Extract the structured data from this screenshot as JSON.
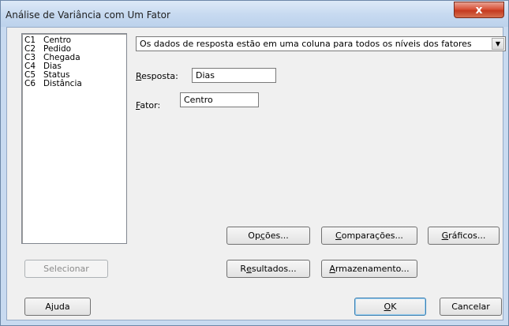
{
  "window": {
    "title": "Análise de Variância com Um Fator",
    "close_glyph": "x"
  },
  "variables": [
    {
      "code": "C1",
      "name": "Centro"
    },
    {
      "code": "C2",
      "name": "Pedido"
    },
    {
      "code": "C3",
      "name": "Chegada"
    },
    {
      "code": "C4",
      "name": "Dias"
    },
    {
      "code": "C5",
      "name": "Status"
    },
    {
      "code": "C6",
      "name": "Distância"
    }
  ],
  "data_layout": {
    "selected": "Os dados de resposta estão em uma coluna para todos os níveis dos fatores",
    "arrow_glyph": "▼"
  },
  "fields": {
    "response": {
      "label_first": "R",
      "label_rest": "esposta:",
      "value": "Dias"
    },
    "factor": {
      "label_first": "F",
      "label_rest": "ator:",
      "value": "Centro"
    }
  },
  "buttons": {
    "options": {
      "pre": "Op",
      "key": "ç",
      "post": "ões..."
    },
    "comparisons": {
      "pre": "",
      "key": "C",
      "post": "omparações..."
    },
    "graphs": {
      "pre": "",
      "key": "G",
      "post": "ráficos..."
    },
    "select": {
      "label": "Selecionar"
    },
    "results": {
      "pre": "R",
      "key": "e",
      "post": "sultados..."
    },
    "storage": {
      "pre": "",
      "key": "A",
      "post": "rmazenamento..."
    },
    "help": {
      "label": "Ajuda"
    },
    "ok": {
      "pre": "",
      "key": "O",
      "post": "K"
    },
    "cancel": {
      "label": "Cancelar"
    }
  }
}
